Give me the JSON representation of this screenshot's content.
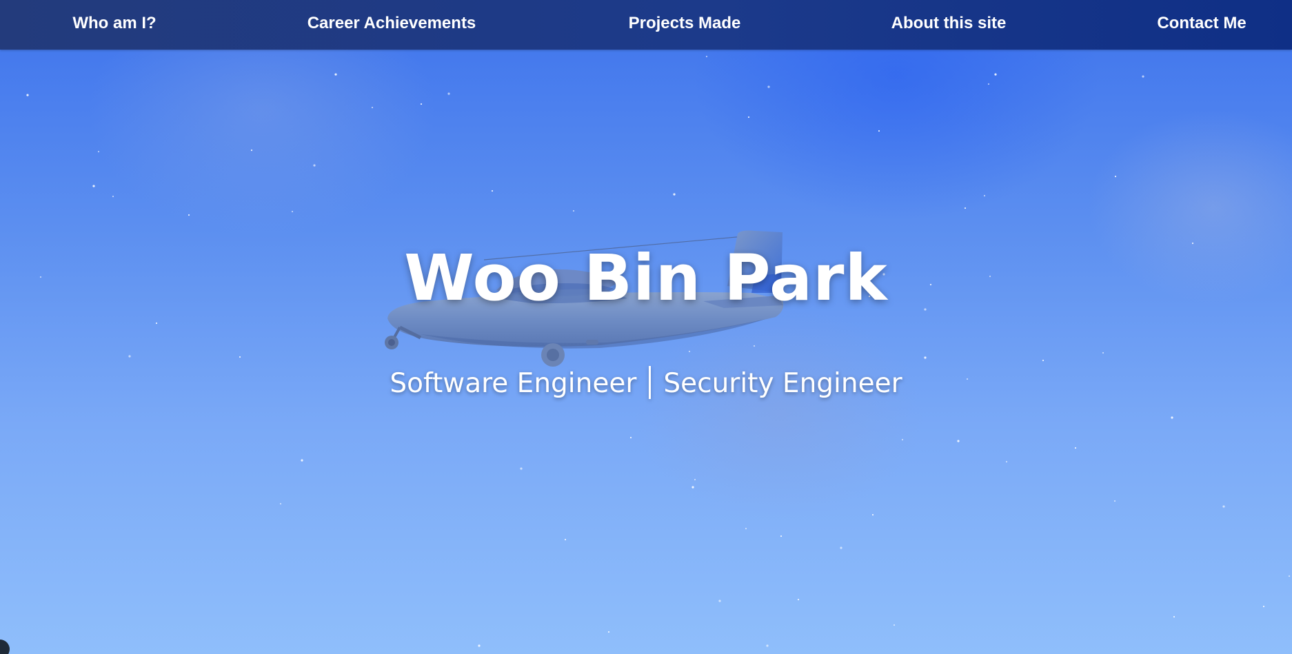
{
  "nav": {
    "items": [
      {
        "label": "Who am I?"
      },
      {
        "label": "Career Achievements"
      },
      {
        "label": "Projects Made"
      },
      {
        "label": "About this site"
      },
      {
        "label": "Contact Me"
      }
    ]
  },
  "hero": {
    "name": "Woo Bin Park",
    "role_primary": "Software Engineer",
    "role_secondary": "Security Engineer"
  },
  "colors": {
    "navbar": "#1c3a8a",
    "sky_top": "#3e73ec",
    "sky_bottom": "#8fbefb",
    "text": "#ffffff"
  },
  "icons": {
    "background_art": "airplane-icon",
    "corner": "scroll-widget-icon"
  }
}
